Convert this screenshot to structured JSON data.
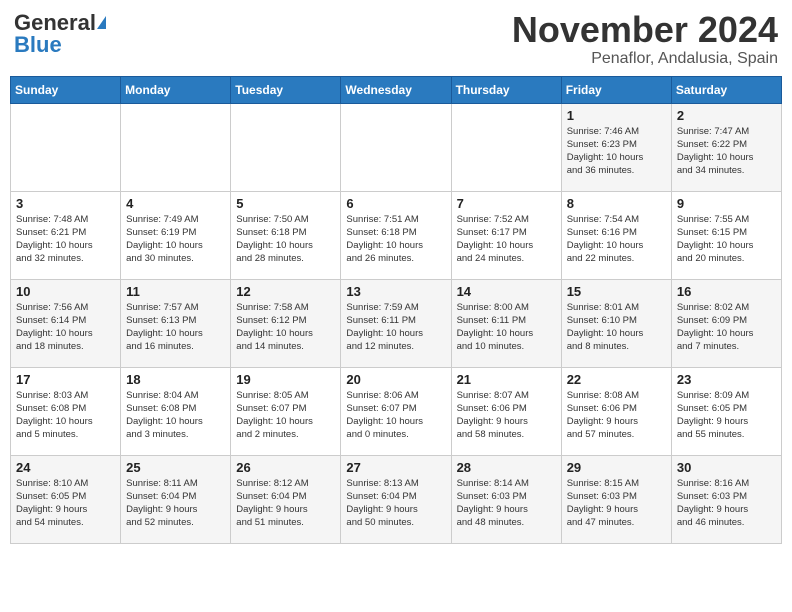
{
  "header": {
    "logo_general": "General",
    "logo_blue": "Blue",
    "title": "November 2024",
    "location": "Penaflor, Andalusia, Spain"
  },
  "days_of_week": [
    "Sunday",
    "Monday",
    "Tuesday",
    "Wednesday",
    "Thursday",
    "Friday",
    "Saturday"
  ],
  "weeks": [
    [
      {
        "day": "",
        "info": ""
      },
      {
        "day": "",
        "info": ""
      },
      {
        "day": "",
        "info": ""
      },
      {
        "day": "",
        "info": ""
      },
      {
        "day": "",
        "info": ""
      },
      {
        "day": "1",
        "info": "Sunrise: 7:46 AM\nSunset: 6:23 PM\nDaylight: 10 hours\nand 36 minutes."
      },
      {
        "day": "2",
        "info": "Sunrise: 7:47 AM\nSunset: 6:22 PM\nDaylight: 10 hours\nand 34 minutes."
      }
    ],
    [
      {
        "day": "3",
        "info": "Sunrise: 7:48 AM\nSunset: 6:21 PM\nDaylight: 10 hours\nand 32 minutes."
      },
      {
        "day": "4",
        "info": "Sunrise: 7:49 AM\nSunset: 6:19 PM\nDaylight: 10 hours\nand 30 minutes."
      },
      {
        "day": "5",
        "info": "Sunrise: 7:50 AM\nSunset: 6:18 PM\nDaylight: 10 hours\nand 28 minutes."
      },
      {
        "day": "6",
        "info": "Sunrise: 7:51 AM\nSunset: 6:18 PM\nDaylight: 10 hours\nand 26 minutes."
      },
      {
        "day": "7",
        "info": "Sunrise: 7:52 AM\nSunset: 6:17 PM\nDaylight: 10 hours\nand 24 minutes."
      },
      {
        "day": "8",
        "info": "Sunrise: 7:54 AM\nSunset: 6:16 PM\nDaylight: 10 hours\nand 22 minutes."
      },
      {
        "day": "9",
        "info": "Sunrise: 7:55 AM\nSunset: 6:15 PM\nDaylight: 10 hours\nand 20 minutes."
      }
    ],
    [
      {
        "day": "10",
        "info": "Sunrise: 7:56 AM\nSunset: 6:14 PM\nDaylight: 10 hours\nand 18 minutes."
      },
      {
        "day": "11",
        "info": "Sunrise: 7:57 AM\nSunset: 6:13 PM\nDaylight: 10 hours\nand 16 minutes."
      },
      {
        "day": "12",
        "info": "Sunrise: 7:58 AM\nSunset: 6:12 PM\nDaylight: 10 hours\nand 14 minutes."
      },
      {
        "day": "13",
        "info": "Sunrise: 7:59 AM\nSunset: 6:11 PM\nDaylight: 10 hours\nand 12 minutes."
      },
      {
        "day": "14",
        "info": "Sunrise: 8:00 AM\nSunset: 6:11 PM\nDaylight: 10 hours\nand 10 minutes."
      },
      {
        "day": "15",
        "info": "Sunrise: 8:01 AM\nSunset: 6:10 PM\nDaylight: 10 hours\nand 8 minutes."
      },
      {
        "day": "16",
        "info": "Sunrise: 8:02 AM\nSunset: 6:09 PM\nDaylight: 10 hours\nand 7 minutes."
      }
    ],
    [
      {
        "day": "17",
        "info": "Sunrise: 8:03 AM\nSunset: 6:08 PM\nDaylight: 10 hours\nand 5 minutes."
      },
      {
        "day": "18",
        "info": "Sunrise: 8:04 AM\nSunset: 6:08 PM\nDaylight: 10 hours\nand 3 minutes."
      },
      {
        "day": "19",
        "info": "Sunrise: 8:05 AM\nSunset: 6:07 PM\nDaylight: 10 hours\nand 2 minutes."
      },
      {
        "day": "20",
        "info": "Sunrise: 8:06 AM\nSunset: 6:07 PM\nDaylight: 10 hours\nand 0 minutes."
      },
      {
        "day": "21",
        "info": "Sunrise: 8:07 AM\nSunset: 6:06 PM\nDaylight: 9 hours\nand 58 minutes."
      },
      {
        "day": "22",
        "info": "Sunrise: 8:08 AM\nSunset: 6:06 PM\nDaylight: 9 hours\nand 57 minutes."
      },
      {
        "day": "23",
        "info": "Sunrise: 8:09 AM\nSunset: 6:05 PM\nDaylight: 9 hours\nand 55 minutes."
      }
    ],
    [
      {
        "day": "24",
        "info": "Sunrise: 8:10 AM\nSunset: 6:05 PM\nDaylight: 9 hours\nand 54 minutes."
      },
      {
        "day": "25",
        "info": "Sunrise: 8:11 AM\nSunset: 6:04 PM\nDaylight: 9 hours\nand 52 minutes."
      },
      {
        "day": "26",
        "info": "Sunrise: 8:12 AM\nSunset: 6:04 PM\nDaylight: 9 hours\nand 51 minutes."
      },
      {
        "day": "27",
        "info": "Sunrise: 8:13 AM\nSunset: 6:04 PM\nDaylight: 9 hours\nand 50 minutes."
      },
      {
        "day": "28",
        "info": "Sunrise: 8:14 AM\nSunset: 6:03 PM\nDaylight: 9 hours\nand 48 minutes."
      },
      {
        "day": "29",
        "info": "Sunrise: 8:15 AM\nSunset: 6:03 PM\nDaylight: 9 hours\nand 47 minutes."
      },
      {
        "day": "30",
        "info": "Sunrise: 8:16 AM\nSunset: 6:03 PM\nDaylight: 9 hours\nand 46 minutes."
      }
    ]
  ]
}
